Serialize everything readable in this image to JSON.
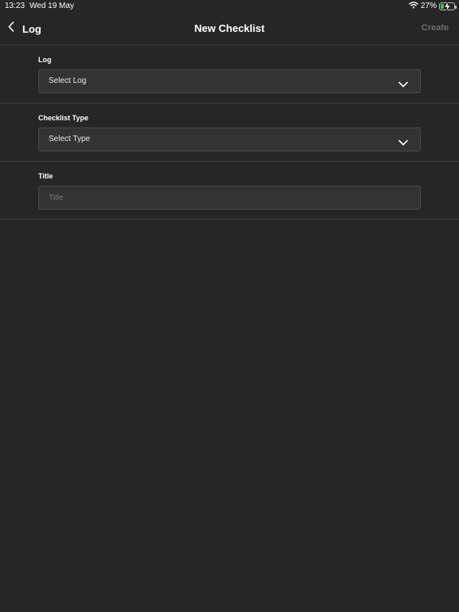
{
  "status_bar": {
    "time": "13:23",
    "date": "Wed 19 May",
    "battery_percent": "27%",
    "battery_level": 0.27,
    "battery_color": "#37c74b"
  },
  "nav": {
    "back_label": "Log",
    "title": "New Checklist",
    "create_label": "Create",
    "create_color": "#6e6e6e"
  },
  "form": {
    "log": {
      "label": "Log",
      "value": "Select Log"
    },
    "checklist_type": {
      "label": "Checklist Type",
      "value": "Select Type"
    },
    "title": {
      "label": "Title",
      "placeholder": "Title",
      "value": ""
    }
  },
  "colors": {
    "background": "#262626",
    "field_background": "#333333",
    "divider": "#3d3d3d"
  }
}
